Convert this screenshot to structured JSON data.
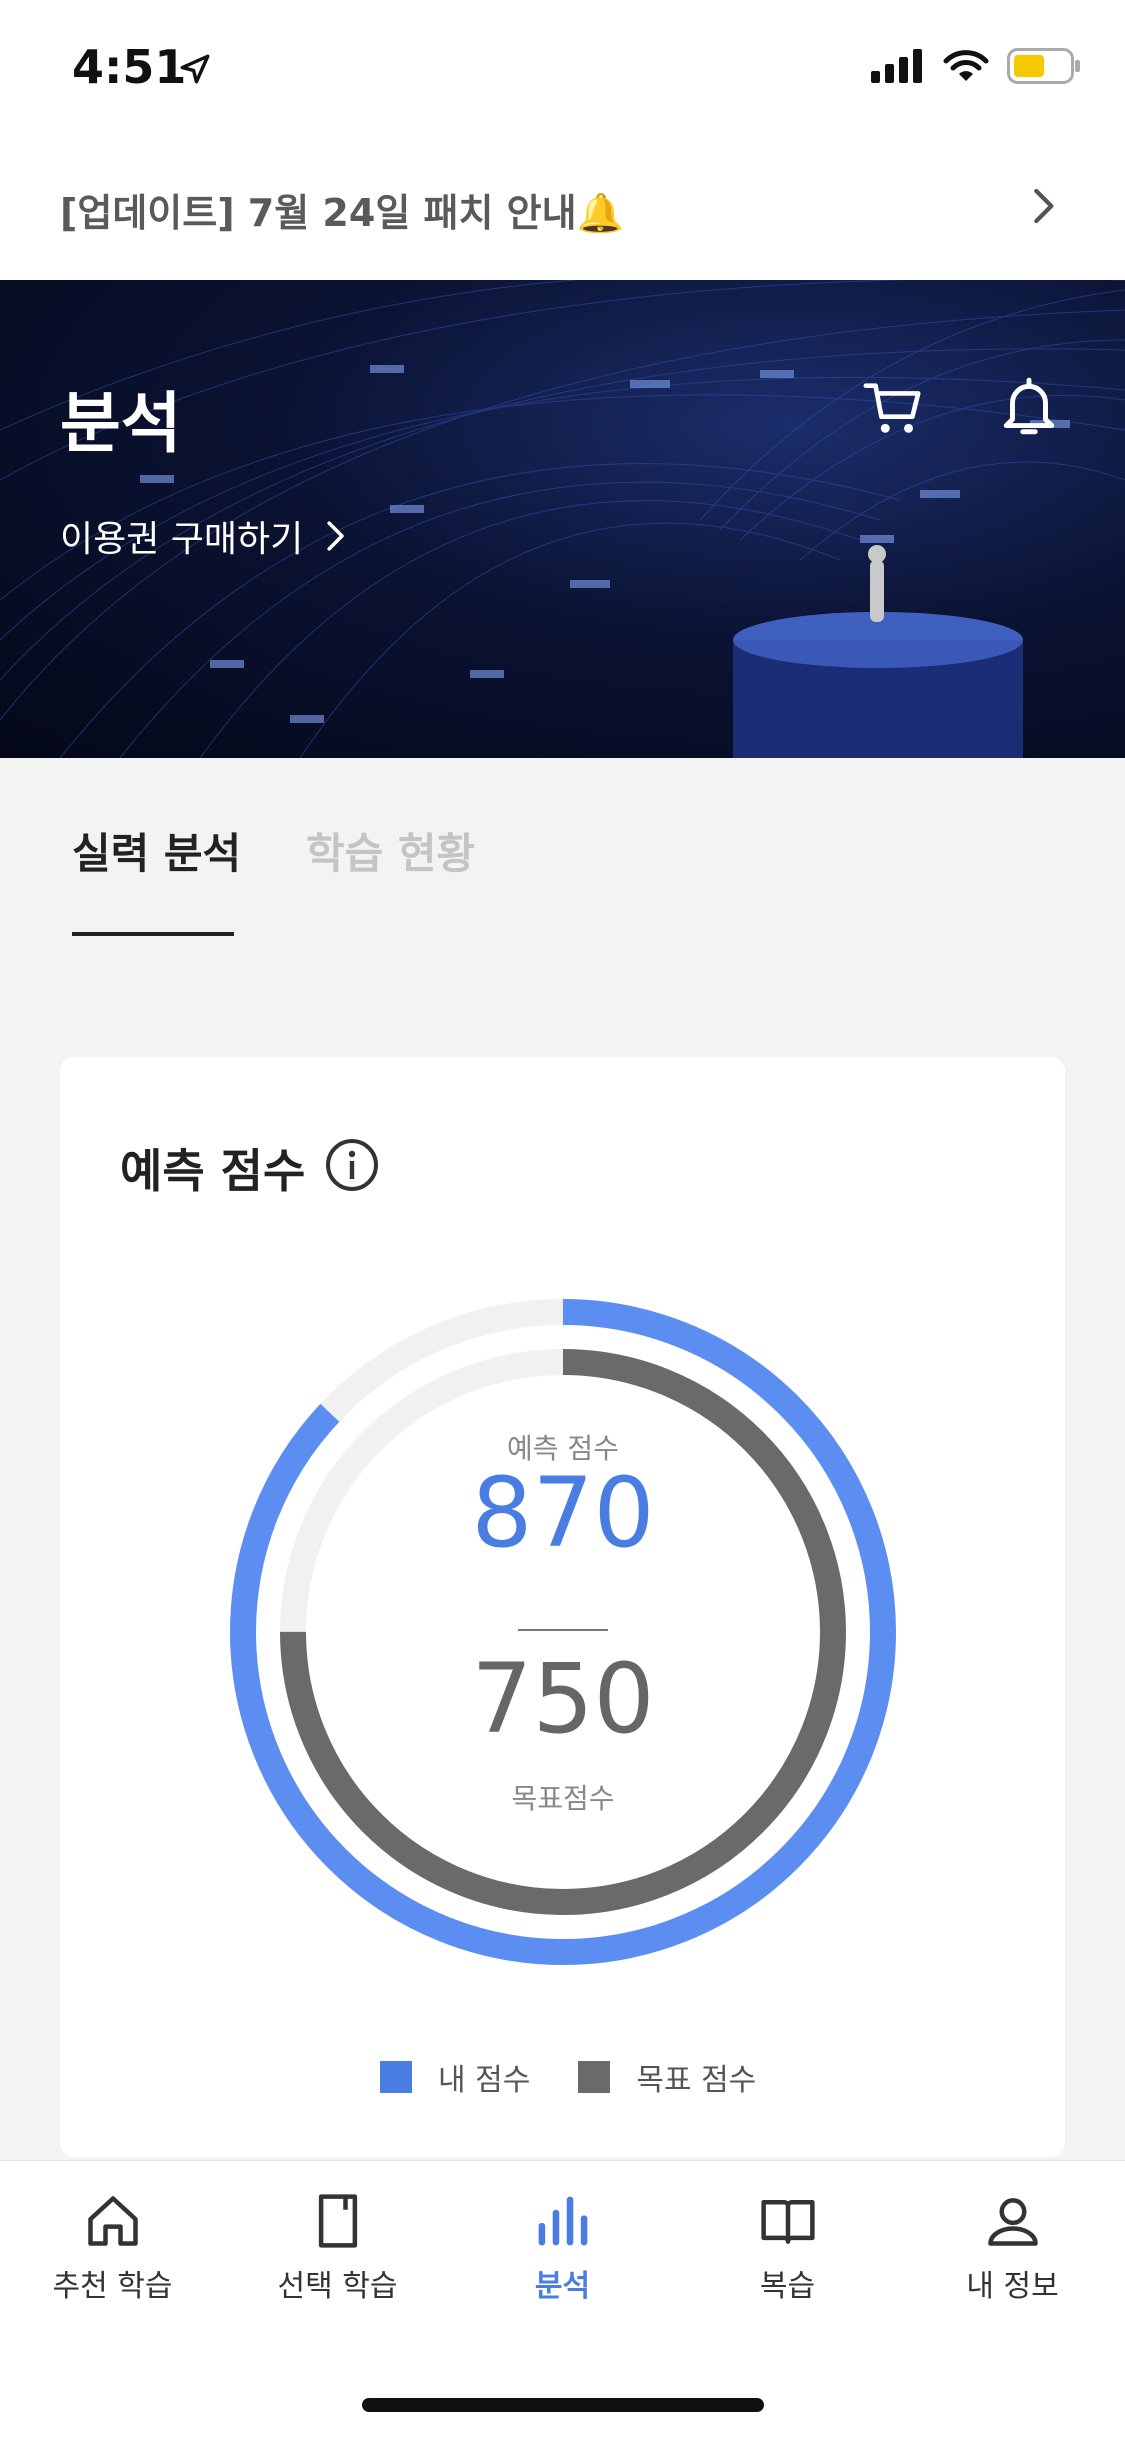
{
  "status_bar": {
    "time": "4:51"
  },
  "notice": {
    "text": "[업데이트] 7월 24일 패치 안내🔔"
  },
  "hero": {
    "title": "분석",
    "link_label": "이용권 구매하기"
  },
  "tabs": [
    {
      "label": "실력 분석",
      "active": true
    },
    {
      "label": "학습 현황",
      "active": false
    }
  ],
  "card": {
    "title": "예측 점수",
    "predicted_label": "예측 점수",
    "predicted_score": "870",
    "target_score": "750",
    "target_label": "목표점수",
    "predicted_fraction": 0.87,
    "target_fraction": 0.75,
    "legend": [
      {
        "label": "내 점수",
        "color": "#4a7de2"
      },
      {
        "label": "목표 점수",
        "color": "#6a6a6a"
      }
    ]
  },
  "tabbar": [
    {
      "label": "추천 학습",
      "icon": "home-icon"
    },
    {
      "label": "선택 학습",
      "icon": "book-icon"
    },
    {
      "label": "분석",
      "icon": "bar-chart-icon",
      "active": true
    },
    {
      "label": "복습",
      "icon": "open-book-icon"
    },
    {
      "label": "내 정보",
      "icon": "user-icon"
    }
  ],
  "colors": {
    "accent": "#4a7de2",
    "ring_blue": "#5b8ef0",
    "ring_gray": "#6a6a6a",
    "track": "#f1f1f1"
  }
}
